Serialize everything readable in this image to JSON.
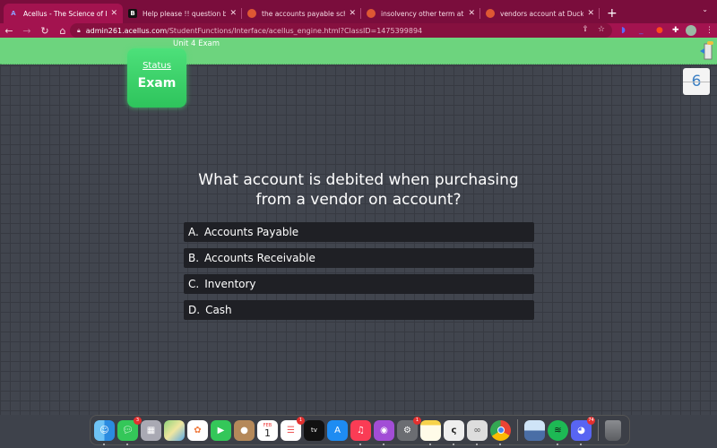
{
  "browser": {
    "tabs": [
      {
        "title": "Acellus - The Science of Learn",
        "favicon": "acellus-icon",
        "active": true
      },
      {
        "title": "Help please !! question below.",
        "favicon": "brainly-icon",
        "active": false
      },
      {
        "title": "the accounts payable schedule",
        "favicon": "duckduckgo-icon",
        "active": false
      },
      {
        "title": "insolvency other term at DuckD",
        "favicon": "duckduckgo-icon",
        "active": false
      },
      {
        "title": "vendors account at DuckDuckG",
        "favicon": "duckduckgo-icon",
        "active": false
      }
    ],
    "new_tab": "+",
    "tab_menu": "⌄",
    "url_host": "admin261.acellus.com",
    "url_path": "/StudentFunctions/Interface/acellus_engine.html?ClassID=1475399894"
  },
  "page": {
    "unit_title": "Unit 4 Exam",
    "status_label": "Status",
    "status_value": "Exam",
    "counter": "6",
    "question": "What account is debited when purchasing from a vendor on account?",
    "answers": [
      {
        "letter": "A.",
        "text": "Accounts Payable"
      },
      {
        "letter": "B.",
        "text": "Accounts Receivable"
      },
      {
        "letter": "C.",
        "text": "Inventory"
      },
      {
        "letter": "D.",
        "text": "Cash"
      }
    ]
  },
  "dock": {
    "apps": [
      {
        "name": "finder",
        "badge": null,
        "running": true
      },
      {
        "name": "messages",
        "badge": "3",
        "running": true
      },
      {
        "name": "launchpad",
        "badge": null,
        "running": false
      },
      {
        "name": "maps",
        "badge": null,
        "running": false
      },
      {
        "name": "photos",
        "badge": null,
        "running": false
      },
      {
        "name": "facetime",
        "badge": null,
        "running": false
      },
      {
        "name": "contacts",
        "badge": null,
        "running": false
      },
      {
        "name": "calendar",
        "badge": null,
        "running": false,
        "month": "FEB",
        "day": "1"
      },
      {
        "name": "reminders",
        "badge": "1",
        "running": false
      },
      {
        "name": "apple-tv",
        "badge": null,
        "running": false,
        "label": "tv"
      },
      {
        "name": "app-store",
        "badge": null,
        "running": false
      },
      {
        "name": "music",
        "badge": null,
        "running": true
      },
      {
        "name": "podcasts",
        "badge": null,
        "running": true
      },
      {
        "name": "system-preferences",
        "badge": "1",
        "running": false
      },
      {
        "name": "notes",
        "badge": null,
        "running": true
      },
      {
        "name": "clip-studio",
        "badge": null,
        "running": true
      },
      {
        "name": "clip-studio-2",
        "badge": null,
        "running": true
      },
      {
        "name": "chrome",
        "badge": null,
        "running": true
      },
      {
        "name": "preview",
        "badge": null,
        "running": false
      },
      {
        "name": "spotify",
        "badge": null,
        "running": true
      },
      {
        "name": "discord",
        "badge": "74",
        "running": true
      },
      {
        "name": "trash",
        "badge": null,
        "running": false
      }
    ]
  }
}
